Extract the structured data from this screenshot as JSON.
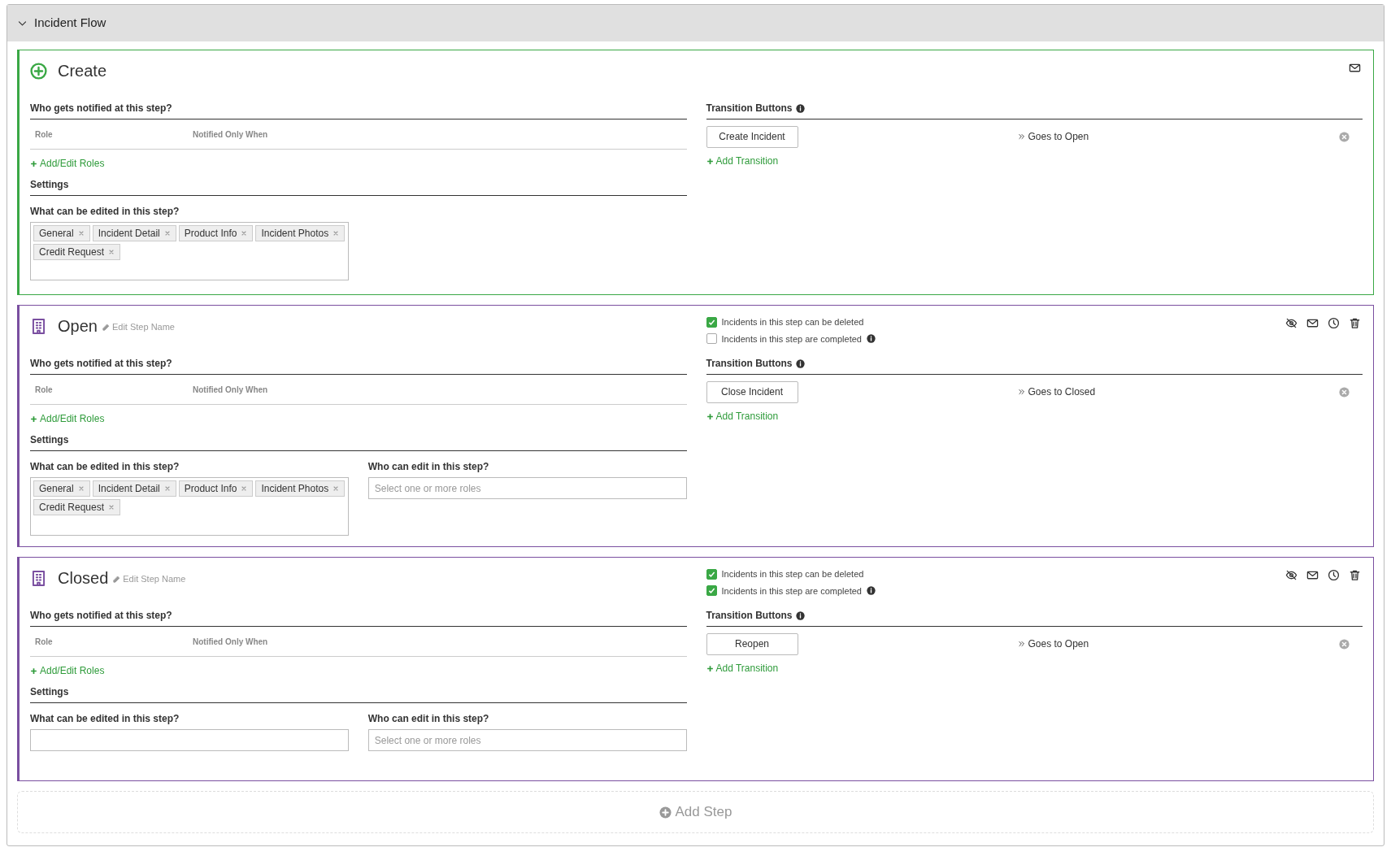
{
  "panel": {
    "title": "Incident Flow",
    "expanded": true
  },
  "steps": [
    {
      "kind": "create",
      "name": "Create",
      "notify": {
        "heading": "Who gets notified at this step?",
        "columns": [
          "Role",
          "Notified Only When"
        ],
        "add_link": "Add/Edit Roles"
      },
      "settings": {
        "heading": "Settings",
        "editable_label": "What can be edited in this step?",
        "editable": [
          "General",
          "Incident Detail",
          "Product Info",
          "Incident Photos",
          "Credit Request"
        ]
      },
      "transitions": {
        "heading": "Transition Buttons",
        "items": [
          {
            "button": "Create Incident",
            "goes_to": "Goes to Open"
          }
        ],
        "add_link": "Add Transition"
      }
    },
    {
      "kind": "step",
      "name": "Open",
      "edit_label": "Edit Step Name",
      "options": [
        {
          "label": "Incidents in this step can be deleted",
          "checked": true,
          "info": false
        },
        {
          "label": "Incidents in this step are completed",
          "checked": false,
          "info": true
        }
      ],
      "notify": {
        "heading": "Who gets notified at this step?",
        "columns": [
          "Role",
          "Notified Only When"
        ],
        "add_link": "Add/Edit Roles"
      },
      "settings": {
        "heading": "Settings",
        "editable_label": "What can be edited in this step?",
        "editable": [
          "General",
          "Incident Detail",
          "Product Info",
          "Incident Photos",
          "Credit Request"
        ],
        "editors_label": "Who can edit in this step?",
        "editors_placeholder": "Select one or more roles"
      },
      "transitions": {
        "heading": "Transition Buttons",
        "items": [
          {
            "button": "Close Incident",
            "goes_to": "Goes to Closed"
          }
        ],
        "add_link": "Add Transition"
      }
    },
    {
      "kind": "step",
      "name": "Closed",
      "edit_label": "Edit Step Name",
      "options": [
        {
          "label": "Incidents in this step can be deleted",
          "checked": true,
          "info": false
        },
        {
          "label": "Incidents in this step are completed",
          "checked": true,
          "info": true
        }
      ],
      "notify": {
        "heading": "Who gets notified at this step?",
        "columns": [
          "Role",
          "Notified Only When"
        ],
        "add_link": "Add/Edit Roles"
      },
      "settings": {
        "heading": "Settings",
        "editable_label": "What can be edited in this step?",
        "editors_label": "Who can edit in this step?",
        "editors_placeholder": "Select one or more roles"
      },
      "transitions": {
        "heading": "Transition Buttons",
        "items": [
          {
            "button": "Reopen",
            "goes_to": "Goes to Open"
          }
        ],
        "add_link": "Add Transition"
      }
    }
  ],
  "add_step": "Add Step"
}
